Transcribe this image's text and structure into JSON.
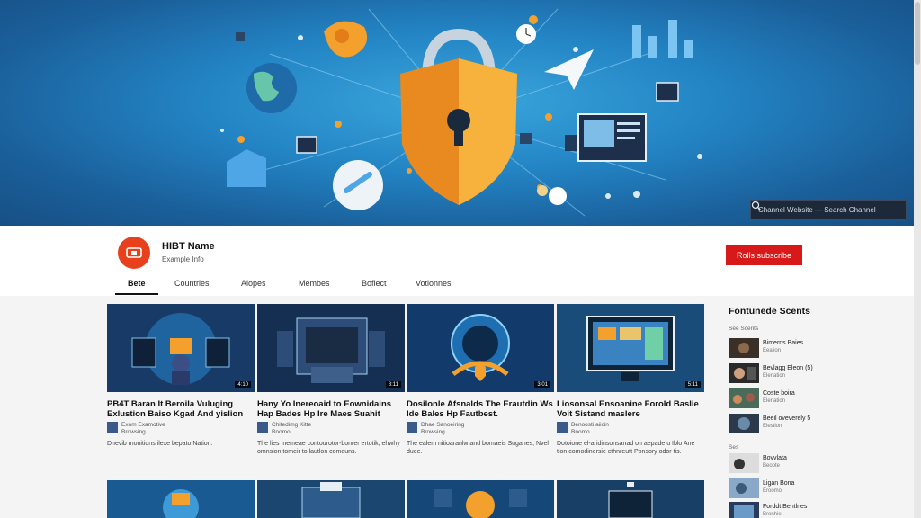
{
  "banner": {
    "search_text": "Channel Website — Search Channel"
  },
  "channel": {
    "name": "HIBT Name",
    "subscribers": "Example Info",
    "subscribe_label": "Rolls subscribe"
  },
  "tabs": [
    {
      "label": "Bete",
      "active": true
    },
    {
      "label": "Countries",
      "active": false
    },
    {
      "label": "Alopes",
      "active": false
    },
    {
      "label": "Membes",
      "active": false
    },
    {
      "label": "Bofiect",
      "active": false
    },
    {
      "label": "Votionnes",
      "active": false
    }
  ],
  "videos": [
    {
      "title": "PB4T Baran It Beroila Vuluging Exlustion Baiso Kgad And yislion",
      "meta1": "Exom Examotive",
      "meta2": "Browsing",
      "desc": "Dnevib monitions ilexe bepato Nation.",
      "duration": "4:10"
    },
    {
      "title": "Hany Yo Inereoaid to Eownidains Hap Bades Hp Ire Maes Suahit",
      "meta1": "Chitedimg Kitte",
      "meta2": "Bnomo",
      "desc": "The lies Inemeae contourotor-bonrer ertotik, ehwhy omnsion tomeir to lautlon comeuns.",
      "duration": "8:11"
    },
    {
      "title": "Dosilonle Afsnalds The Erautdin Ws Ide Bales Hp Fautbest.",
      "meta1": "Dhae Sanoeiring",
      "meta2": "Browsing",
      "desc": "The ealem nitioaranlw and bomaeis Suganes, Nvel duee.",
      "duration": "3:01"
    },
    {
      "title": "Liosonsal Ensoanine Forold Baslie Voit Sistand maslere",
      "meta1": "Benoosti aiicin",
      "meta2": "Bnomo",
      "desc": "Dotoione el-aridinsonsanad on aepade u Iblo Ane tion comodinersie cthnreutt Ponsory odor tis.",
      "duration": "5:11"
    }
  ],
  "sidebar": {
    "title": "Fontunede Scents",
    "subtitle": "See Scents",
    "section_label": "Ses",
    "items": [
      {
        "title": "Bimerns Baies",
        "sub": "Eeaiion"
      },
      {
        "title": "Bevlagg Eleon (5)",
        "sub": "Elenation"
      },
      {
        "title": "Coste boira",
        "sub": "Elenation"
      },
      {
        "title": "Beeil oveverely 5",
        "sub": "Elestion"
      },
      {
        "title": "Bovvlata",
        "sub": "Beoote"
      },
      {
        "title": "Ligan Bona",
        "sub": "Eroomo"
      },
      {
        "title": "Forddt Bentlnes",
        "sub": "Bronhie"
      }
    ]
  },
  "colors": {
    "accent": "#d81919",
    "avatar": "#e8401c",
    "banner_blue": "#2384c4",
    "shield_orange": "#f3a02c"
  }
}
